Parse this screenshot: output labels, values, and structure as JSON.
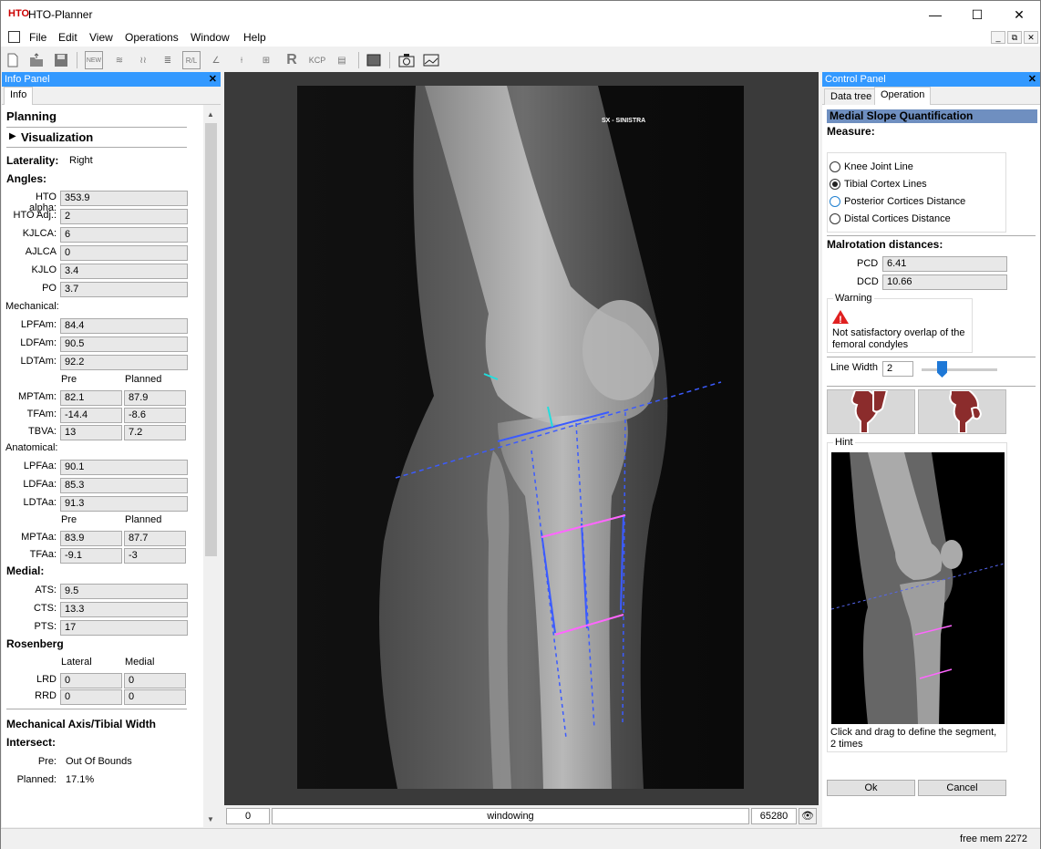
{
  "app": {
    "title": "HTO-Planner",
    "icon_text": "HTO"
  },
  "window_controls": {
    "minimize": "—",
    "maximize": "☐",
    "close": "✕"
  },
  "menu": [
    "File",
    "Edit",
    "View",
    "Operations",
    "Window",
    "Help"
  ],
  "mdi_controls": [
    "_",
    "⧉",
    "✕"
  ],
  "toolbar": {
    "new_label": "NEW",
    "rl_label": "R/L",
    "r_label": "R",
    "kcp_label": "KCP"
  },
  "info_panel": {
    "title": "Info Panel",
    "close": "✕",
    "tab": "Info",
    "planning": "Planning",
    "visualization": "Visualization",
    "laterality_label": "Laterality:",
    "laterality_value": "Right",
    "angles": "Angles:",
    "hto_alpha": {
      "label": "HTO alpha:",
      "value": "353.9"
    },
    "hto_adj": {
      "label": "HTO Adj.:",
      "value": "2"
    },
    "kjlca": {
      "label": "KJLCA:",
      "value": "6"
    },
    "ajlca": {
      "label": "AJLCA",
      "value": "0"
    },
    "kjlo": {
      "label": "KJLO",
      "value": "3.4"
    },
    "po": {
      "label": "PO",
      "value": "3.7"
    },
    "mechanical": "Mechanical:",
    "lpfam": {
      "label": "LPFAm:",
      "value": "84.4"
    },
    "ldfam": {
      "label": "LDFAm:",
      "value": "90.5"
    },
    "ldtam": {
      "label": "LDTAm:",
      "value": "92.2"
    },
    "pre": "Pre",
    "planned": "Planned",
    "mptam": {
      "label": "MPTAm:",
      "pre": "82.1",
      "planned": "87.9"
    },
    "tfam": {
      "label": "TFAm:",
      "pre": "-14.4",
      "planned": "-8.6"
    },
    "tbva": {
      "label": "TBVA:",
      "pre": "13",
      "planned": "7.2"
    },
    "anatomical": "Anatomical:",
    "lpfaa": {
      "label": "LPFAa:",
      "value": "90.1"
    },
    "ldfaa": {
      "label": "LDFAa:",
      "value": "85.3"
    },
    "ldtaa": {
      "label": "LDTAa:",
      "value": "91.3"
    },
    "mptaa": {
      "label": "MPTAa:",
      "pre": "83.9",
      "planned": "87.7"
    },
    "tfaa": {
      "label": "TFAa:",
      "pre": "-9.1",
      "planned": "-3"
    },
    "medial": "Medial:",
    "ats": {
      "label": "ATS:",
      "value": "9.5"
    },
    "cts": {
      "label": "CTS:",
      "value": "13.3"
    },
    "pts": {
      "label": "PTS:",
      "value": "17"
    },
    "rosenberg": "Rosenberg",
    "lateral": "Lateral",
    "medial_col": "Medial",
    "lrd": {
      "label": "LRD",
      "lateral": "0",
      "medial": "0"
    },
    "rrd": {
      "label": "RRD",
      "lateral": "0",
      "medial": "0"
    },
    "mech_axis": "Mechanical Axis/Tibial Width",
    "intersect": "Intersect:",
    "pre_label": "Pre:",
    "pre_value": "Out Of Bounds",
    "planned_label": "Planned:",
    "planned_value": "17.1%"
  },
  "viewer": {
    "marker": "SX - SINISTRA",
    "window_min": "0",
    "mode": "windowing",
    "window_max": "65280",
    "eye_icon": "👁"
  },
  "control_panel": {
    "title": "Control Panel",
    "close": "✕",
    "tabs": [
      "Data tree",
      "Operation"
    ],
    "section": "Medial Slope Quantification",
    "measure": "Measure:",
    "options": [
      "Knee Joint Line",
      "Tibial Cortex Lines",
      "Posterior Cortices Distance",
      "Distal Cortices Distance"
    ],
    "selected_option": "Tibial Cortex Lines",
    "malrotation": "Malrotation distances:",
    "pcd": {
      "label": "PCD",
      "value": "6.41"
    },
    "dcd": {
      "label": "DCD",
      "value": "10.66"
    },
    "warning_title": "Warning",
    "warning_text": "Not satisfactory overlap of the femoral condyles",
    "line_width_label": "Line Width",
    "line_width_value": "2",
    "hint_title": "Hint",
    "hint_text": "Click and drag to define the segment, 2 times",
    "ok": "Ok",
    "cancel": "Cancel"
  },
  "status": {
    "mem": "free mem 2272"
  }
}
